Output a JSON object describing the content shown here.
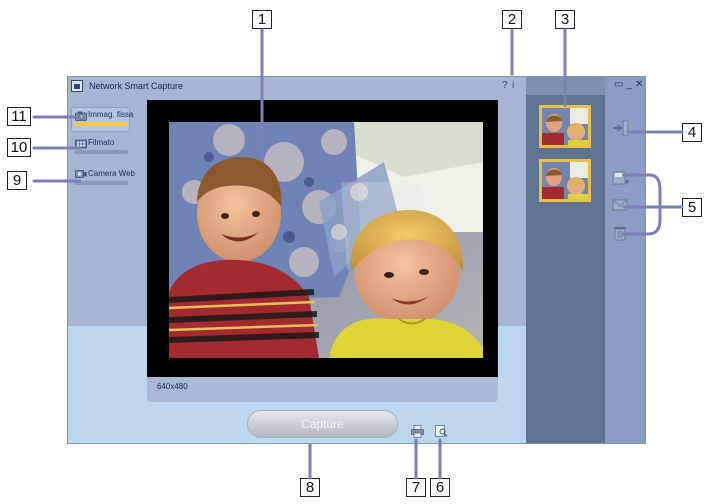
{
  "window": {
    "title": "Network Smart Capture",
    "help_glyph": "?",
    "info_glyph": "i",
    "controls": "▭_✕"
  },
  "modes": [
    {
      "label": "Immag. fissa",
      "icon": "camera-icon"
    },
    {
      "label": "Filmato",
      "icon": "film-icon"
    },
    {
      "label": "Camera Web",
      "icon": "webcam-icon"
    }
  ],
  "preview": {
    "resolution": "640x480"
  },
  "capture": {
    "label": "Capture"
  },
  "thumbnails": [
    {
      "selected": true
    },
    {
      "selected": false
    }
  ],
  "tools": [
    "export-icon",
    "save-icon",
    "email-icon",
    "trash-icon"
  ],
  "bottom_tools": [
    "print-icon",
    "zoom-icon"
  ],
  "callouts": [
    "1",
    "2",
    "3",
    "4",
    "5",
    "6",
    "7",
    "8",
    "9",
    "10",
    "11"
  ],
  "colors": {
    "accent": "#e7bf4d",
    "window_bg": "#bcd8ee",
    "thumb_panel": "#5f7393",
    "tool_panel": "#8d9cc2",
    "callout_line": "#7d7fb8"
  }
}
